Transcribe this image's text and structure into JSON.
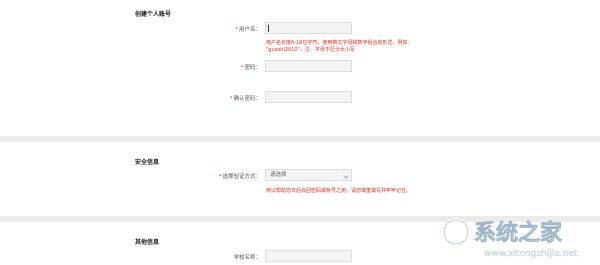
{
  "account": {
    "title": "创建个人账号",
    "username": {
      "label": "用户名：",
      "value": "",
      "error_line1": "用户名长度6-16位字符，使用英文字母和数字组合的形式，例如:",
      "error_line2": "\"guoshi2010\"，注：字母不区分大小写"
    },
    "password": {
      "label": "密码：",
      "value": ""
    },
    "confirm": {
      "label": "确认密码：",
      "value": ""
    },
    "required_mark": "*"
  },
  "security": {
    "title": "安全信息",
    "method": {
      "label": "选择验证方式：",
      "selected": "请选择",
      "note": "用以帮助您日后找回密码或帐号之用，请您慎重填写并牢牢记住。"
    }
  },
  "other": {
    "title": "其他信息",
    "school": {
      "label": "学校名称：",
      "value": ""
    }
  },
  "watermark": {
    "text": "系统之家",
    "url": "www.xitongzhijia.net"
  }
}
